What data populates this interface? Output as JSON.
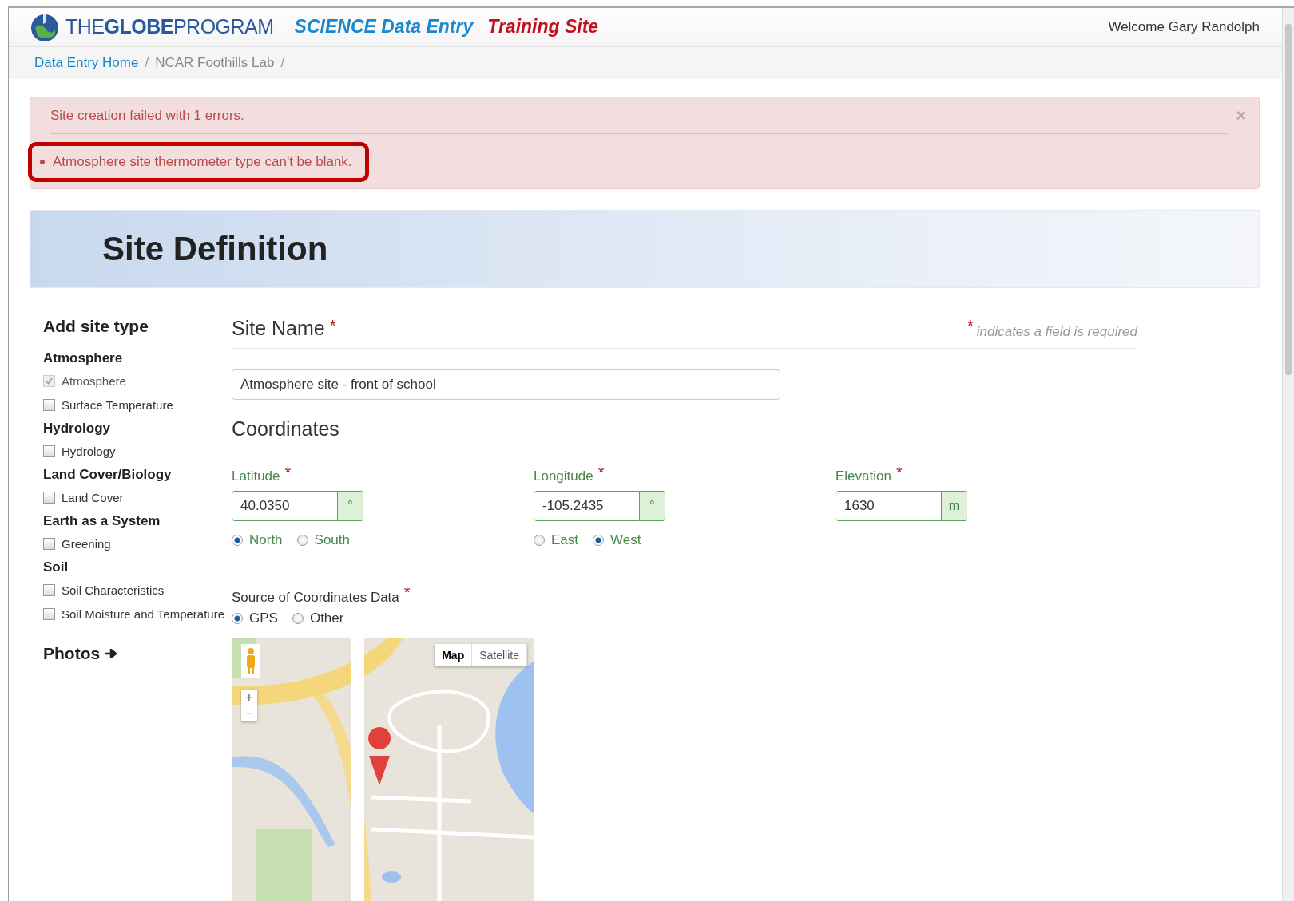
{
  "header": {
    "logo": "THE**GLOBE**PROGRAM",
    "app_title": "SCIENCE Data Entry",
    "site_badge": "Training Site",
    "welcome": "Welcome Gary Randolph"
  },
  "breadcrumb": [
    {
      "label": "Data Entry Home",
      "kind": "link"
    },
    {
      "label": "NCAR Foothills Lab",
      "kind": "current"
    }
  ],
  "breadcrumb_separator": "/",
  "alert": {
    "message": "Site creation failed with 1 errors.",
    "close": "×",
    "errors": [
      {
        "text": "Atmosphere site thermometer type can't be blank.",
        "highlighted": true
      }
    ]
  },
  "page_title": "Site Definition",
  "sidebar": {
    "title": "Add site type",
    "groups": [
      {
        "name": "Atmosphere",
        "items": [
          {
            "label": "Atmosphere",
            "checked": true,
            "disabled": true
          },
          {
            "label": "Surface Temperature",
            "checked": false,
            "disabled": false
          }
        ]
      },
      {
        "name": "Hydrology",
        "items": [
          {
            "label": "Hydrology",
            "checked": false,
            "disabled": false
          }
        ]
      },
      {
        "name": "Land Cover/Biology",
        "items": [
          {
            "label": "Land Cover",
            "checked": false,
            "disabled": false
          }
        ]
      },
      {
        "name": "Earth as a System",
        "items": [
          {
            "label": "Greening",
            "checked": false,
            "disabled": false
          }
        ]
      },
      {
        "name": "Soil",
        "items": [
          {
            "label": "Soil Characteristics",
            "checked": false,
            "disabled": false
          },
          {
            "label": "Soil Moisture and Temperature",
            "checked": false,
            "disabled": false
          }
        ]
      }
    ],
    "photos": "Photos"
  },
  "site_name": {
    "heading": "Site Name",
    "required_mark": "*",
    "note_mark": "*",
    "note": "indicates a field is required",
    "value": "Atmosphere site - front of school"
  },
  "coordinates": {
    "heading": "Coordinates",
    "fields": [
      {
        "label": "Latitude",
        "required_mark": "*",
        "value": "40.0350",
        "unit": "°",
        "options": [
          {
            "label": "North",
            "selected": true
          },
          {
            "label": "South",
            "selected": false
          }
        ]
      },
      {
        "label": "Longitude",
        "required_mark": "*",
        "value": "-105.2435",
        "unit": "°",
        "options": [
          {
            "label": "East",
            "selected": false
          },
          {
            "label": "West",
            "selected": true
          }
        ]
      },
      {
        "label": "Elevation",
        "required_mark": "*",
        "value": "1630",
        "unit": "m"
      }
    ],
    "source": {
      "label": "Source of Coordinates Data",
      "required_mark": "*",
      "options": [
        {
          "label": "GPS",
          "selected": true
        },
        {
          "label": "Other",
          "selected": false
        }
      ]
    }
  },
  "map": {
    "kind": "picture",
    "view_buttons": [
      {
        "label": "Map",
        "selected": true
      },
      {
        "label": "Satellite",
        "selected": false
      }
    ],
    "zoom_in": "+",
    "zoom_out": "−"
  }
}
